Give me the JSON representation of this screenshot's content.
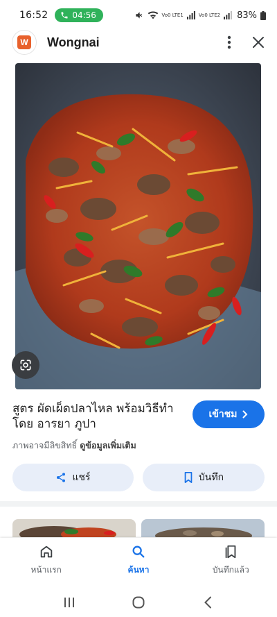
{
  "status_bar": {
    "time": "16:52",
    "call_timer": "04:56",
    "battery": "83%",
    "sim1_tag": "Vo0 LTE1",
    "sim2_tag": "Vo0 LTE2"
  },
  "header": {
    "app_name": "Wongnai",
    "logo_letter": "W",
    "logo_color": "#e8612c"
  },
  "result": {
    "title": "สูตร ผัดเผ็ดปลาไหล พร้อมวิธีทำโดย อารยา ภูปา",
    "visit_label": "เข้าชม",
    "copyright_text": "ภาพอาจมีลิขสิทธิ์",
    "more_info_link": "ดูข้อมูลเพิ่มเติม",
    "share_label": "แชร์",
    "save_label": "บันทึก"
  },
  "bottom_nav": {
    "items": [
      {
        "label": "หน้าแรก",
        "icon": "home-icon",
        "active": false
      },
      {
        "label": "ค้นหา",
        "icon": "search-icon",
        "active": true
      },
      {
        "label": "บันทึกแล้ว",
        "icon": "bookmarks-icon",
        "active": false
      }
    ]
  },
  "colors": {
    "accent": "#1a73e8",
    "pill_background": "#e8eef9",
    "call_green": "#2fb25a"
  }
}
